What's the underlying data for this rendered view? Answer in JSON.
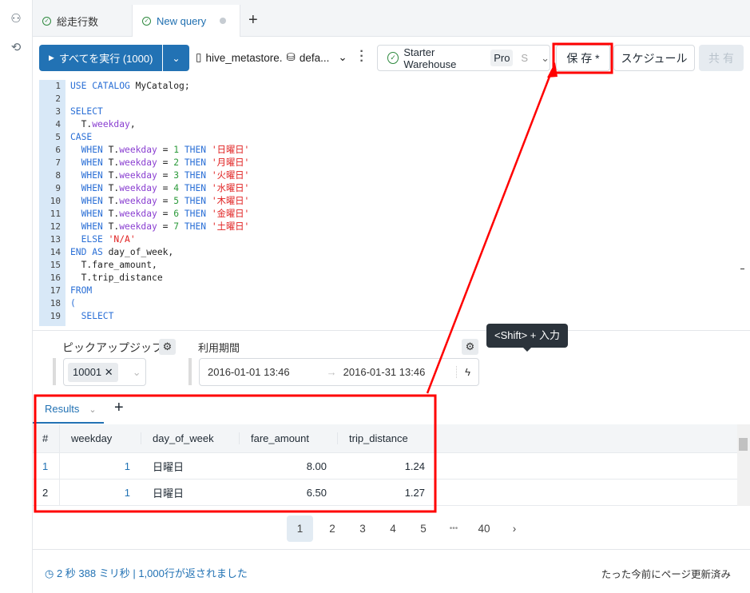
{
  "tabs": [
    {
      "label": "総走行数",
      "status": "success"
    },
    {
      "label": "New query",
      "status": "unsaved"
    }
  ],
  "toolbar": {
    "run_label": "すべてを実行 (1000)",
    "catalog": "hive_metastore.",
    "schema": "defa...",
    "warehouse": "Starter Warehouse",
    "warehouse_tier": "Pro",
    "warehouse_size": "S",
    "save_label": "保 存 *",
    "schedule_label": "スケジュール",
    "share_label": "共 有"
  },
  "editor": {
    "lines": [
      [
        [
          "USE CATALOG ",
          "k"
        ],
        [
          "MyCatalog;",
          "p"
        ]
      ],
      [],
      [
        [
          "SELECT",
          "k"
        ]
      ],
      [
        [
          "  T.",
          "p"
        ],
        [
          "weekday",
          "f"
        ],
        [
          ",",
          "p"
        ]
      ],
      [
        [
          "CASE",
          "k"
        ]
      ],
      [
        [
          "  WHEN ",
          "k"
        ],
        [
          "T.",
          "p"
        ],
        [
          "weekday",
          "f"
        ],
        [
          " = ",
          "p"
        ],
        [
          "1",
          "n"
        ],
        [
          " THEN ",
          "k"
        ],
        [
          "'日曜日'",
          "s"
        ]
      ],
      [
        [
          "  WHEN ",
          "k"
        ],
        [
          "T.",
          "p"
        ],
        [
          "weekday",
          "f"
        ],
        [
          " = ",
          "p"
        ],
        [
          "2",
          "n"
        ],
        [
          " THEN ",
          "k"
        ],
        [
          "'月曜日'",
          "s"
        ]
      ],
      [
        [
          "  WHEN ",
          "k"
        ],
        [
          "T.",
          "p"
        ],
        [
          "weekday",
          "f"
        ],
        [
          " = ",
          "p"
        ],
        [
          "3",
          "n"
        ],
        [
          " THEN ",
          "k"
        ],
        [
          "'火曜日'",
          "s"
        ]
      ],
      [
        [
          "  WHEN ",
          "k"
        ],
        [
          "T.",
          "p"
        ],
        [
          "weekday",
          "f"
        ],
        [
          " = ",
          "p"
        ],
        [
          "4",
          "n"
        ],
        [
          " THEN ",
          "k"
        ],
        [
          "'水曜日'",
          "s"
        ]
      ],
      [
        [
          "  WHEN ",
          "k"
        ],
        [
          "T.",
          "p"
        ],
        [
          "weekday",
          "f"
        ],
        [
          " = ",
          "p"
        ],
        [
          "5",
          "n"
        ],
        [
          " THEN ",
          "k"
        ],
        [
          "'木曜日'",
          "s"
        ]
      ],
      [
        [
          "  WHEN ",
          "k"
        ],
        [
          "T.",
          "p"
        ],
        [
          "weekday",
          "f"
        ],
        [
          " = ",
          "p"
        ],
        [
          "6",
          "n"
        ],
        [
          " THEN ",
          "k"
        ],
        [
          "'金曜日'",
          "s"
        ]
      ],
      [
        [
          "  WHEN ",
          "k"
        ],
        [
          "T.",
          "p"
        ],
        [
          "weekday",
          "f"
        ],
        [
          " = ",
          "p"
        ],
        [
          "7",
          "n"
        ],
        [
          " THEN ",
          "k"
        ],
        [
          "'土曜日'",
          "s"
        ]
      ],
      [
        [
          "  ELSE ",
          "k"
        ],
        [
          "'N/A'",
          "s"
        ]
      ],
      [
        [
          "END AS ",
          "k"
        ],
        [
          "day_of_week,",
          "p"
        ]
      ],
      [
        [
          "  T.fare_amount,",
          "p"
        ]
      ],
      [
        [
          "  T.trip_distance",
          "p"
        ]
      ],
      [
        [
          "FROM",
          "k"
        ]
      ],
      [
        [
          "(",
          "k"
        ]
      ],
      [
        [
          "  SELECT",
          "k"
        ]
      ]
    ]
  },
  "params": {
    "pickup_label": "ピックアップジップ",
    "pickup_value": "10001",
    "period_label": "利用期間",
    "start": "2016-01-01 13:46",
    "end": "2016-01-31 13:46",
    "tooltip": "<Shift> + 入力"
  },
  "results": {
    "tab_label": "Results",
    "columns": [
      "#",
      "weekday",
      "day_of_week",
      "fare_amount",
      "trip_distance"
    ],
    "rows": [
      [
        "1",
        "1",
        "日曜日",
        "8.00",
        "1.24"
      ],
      [
        "2",
        "1",
        "日曜日",
        "6.50",
        "1.27"
      ]
    ]
  },
  "pagination": {
    "pages": [
      "1",
      "2",
      "3",
      "4",
      "5",
      "•••",
      "40"
    ],
    "current": "1"
  },
  "footer": {
    "status": "2 秒 388 ミリ秒 | 1,000行が返されました",
    "updated": "たった今前にページ更新済み"
  },
  "colors": {
    "primary": "#2272b4",
    "annotation": "#ff0000"
  }
}
